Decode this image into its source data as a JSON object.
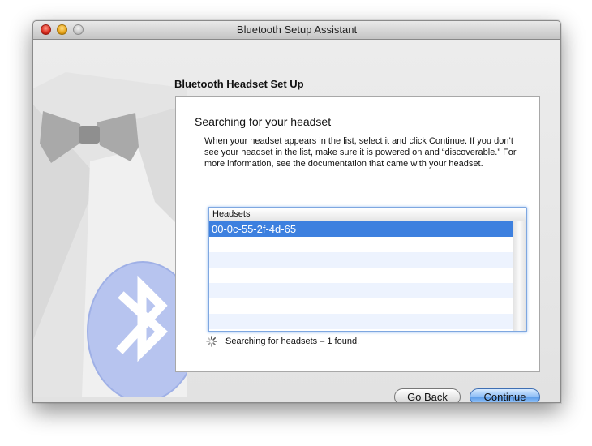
{
  "window": {
    "title": "Bluetooth Setup Assistant"
  },
  "page": {
    "heading": "Bluetooth Headset Set Up",
    "panel_title": "Searching for your headset",
    "instructions": "When your headset appears in the list, select it and click Continue. If you don’t see your headset in the list, make sure it is powered on and “discoverable.”  For more information, see the documentation that came with your headset."
  },
  "headsets": {
    "column_header": "Headsets",
    "items": [
      "00-0c-55-2f-4d-65"
    ],
    "selected_index": 0
  },
  "status": {
    "text": "Searching for headsets – 1 found."
  },
  "buttons": {
    "back": "Go Back",
    "continue": "Continue"
  },
  "colors": {
    "selection": "#3d80df",
    "alt_row": "#edf3fe",
    "focus_ring": "#7ea7e0",
    "bluetooth_badge": "#b7c4ef"
  },
  "icons": {
    "artwork": "tuxedo-bluetooth-art",
    "spinner": "progress-spinner-icon"
  }
}
